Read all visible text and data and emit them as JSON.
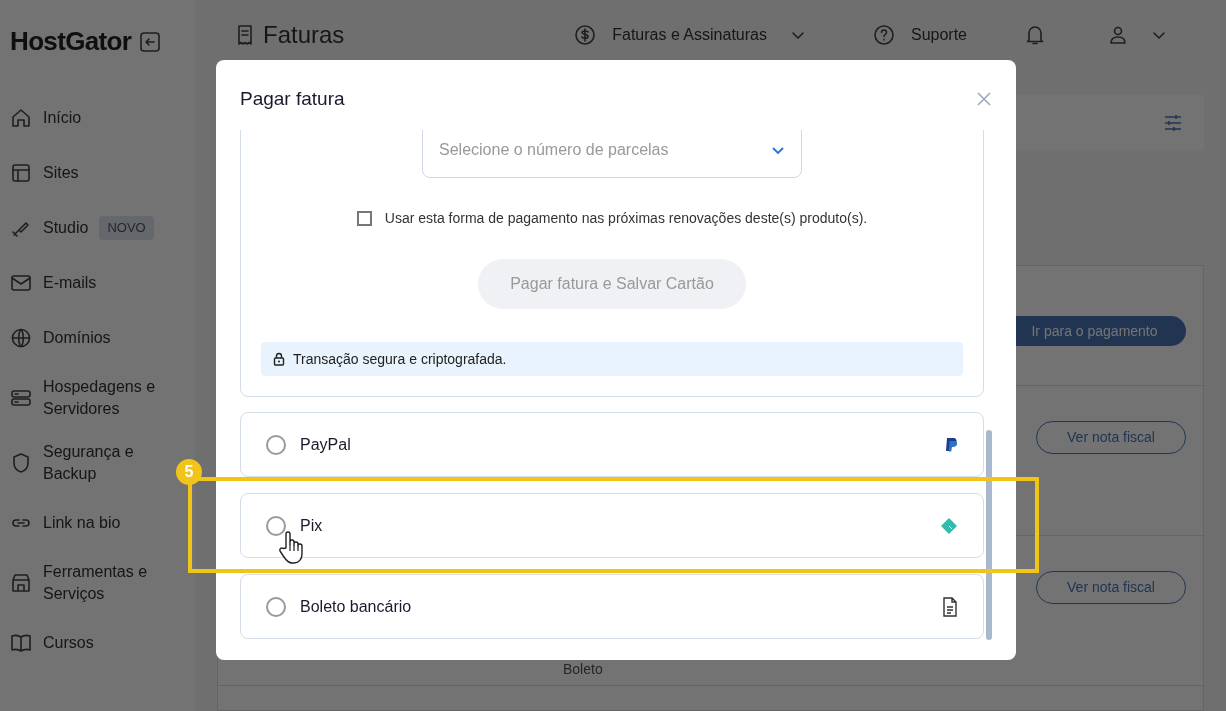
{
  "sidebar": {
    "logo": "HostGator",
    "items": [
      {
        "label": "Início"
      },
      {
        "label": "Sites"
      },
      {
        "label": "Studio",
        "badge": "NOVO"
      },
      {
        "label": "E-mails"
      },
      {
        "label": "Domínios"
      },
      {
        "label": "Hospedagens e Servidores"
      },
      {
        "label": "Segurança e Backup"
      },
      {
        "label": "Link na bio"
      },
      {
        "label": "Ferramentas e Serviços"
      },
      {
        "label": "Cursos"
      }
    ]
  },
  "header": {
    "title": "Faturas",
    "menu": "Faturas e Assinaturas",
    "support": "Suporte"
  },
  "page": {
    "pay_button": "Ir para o pagamento",
    "invoice_buttons": [
      "Ver nota fiscal",
      "Ver nota fiscal"
    ],
    "method_text": "Boleto"
  },
  "modal": {
    "title": "Pagar fatura",
    "installments": {
      "placeholder": "Selecione o número de parcelas"
    },
    "save_method": {
      "label": "Usar esta forma de pagamento nas próximas renovações deste(s) produto(s).",
      "checked": false
    },
    "submit": {
      "label": "Pagar fatura e Salvar Cartão",
      "disabled": true
    },
    "secure_note": "Transação segura e criptografada.",
    "options": [
      {
        "label": "PayPal",
        "kind": "paypal",
        "selected": false
      },
      {
        "label": "Pix",
        "kind": "pix",
        "selected": false
      },
      {
        "label": "Boleto bancário",
        "kind": "boleto",
        "selected": false
      }
    ]
  },
  "annotation": {
    "step": "5"
  }
}
